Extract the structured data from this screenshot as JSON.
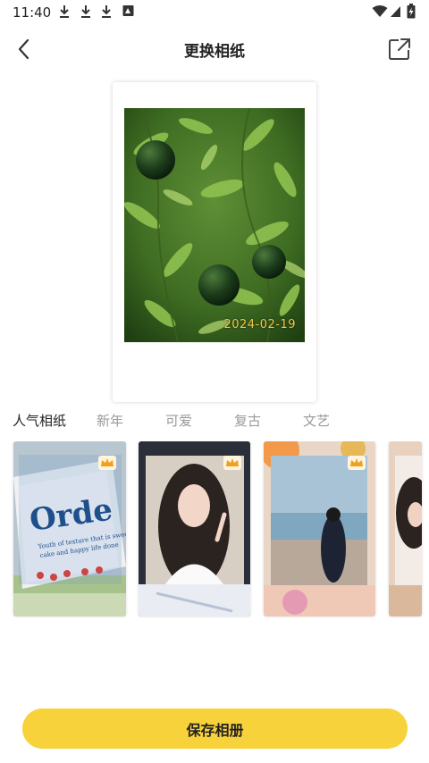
{
  "status_bar": {
    "time": "11:40",
    "left_icons": [
      "download-icon",
      "download-icon",
      "download-icon",
      "image-icon"
    ],
    "right_icons": [
      "wifi-icon",
      "signal-icon",
      "battery-charging-icon"
    ]
  },
  "header": {
    "title": "更换相纸",
    "back_icon": "chevron-left-icon",
    "share_icon": "share-external-icon"
  },
  "frame": {
    "date_stamp": "2024-02-19"
  },
  "tabs": [
    {
      "label": "人气相纸",
      "active": true
    },
    {
      "label": "新年",
      "active": false
    },
    {
      "label": "可爱",
      "active": false
    },
    {
      "label": "复古",
      "active": false
    },
    {
      "label": "文艺",
      "active": false
    }
  ],
  "templates": {
    "premium_icon": "crown-icon",
    "items": [
      {
        "poster_text": "Orde",
        "subtitle_lines": [
          "Youth of texture that is sweet",
          "cake and happy life done"
        ]
      },
      {
        "poster_text": ""
      },
      {
        "poster_text": ""
      },
      {
        "poster_text": ""
      }
    ]
  },
  "save_button": {
    "label": "保存相册"
  },
  "colors": {
    "accent": "#f8d23a",
    "date_stamp": "#f2c84a",
    "tab_inactive": "#9a9a9a"
  }
}
